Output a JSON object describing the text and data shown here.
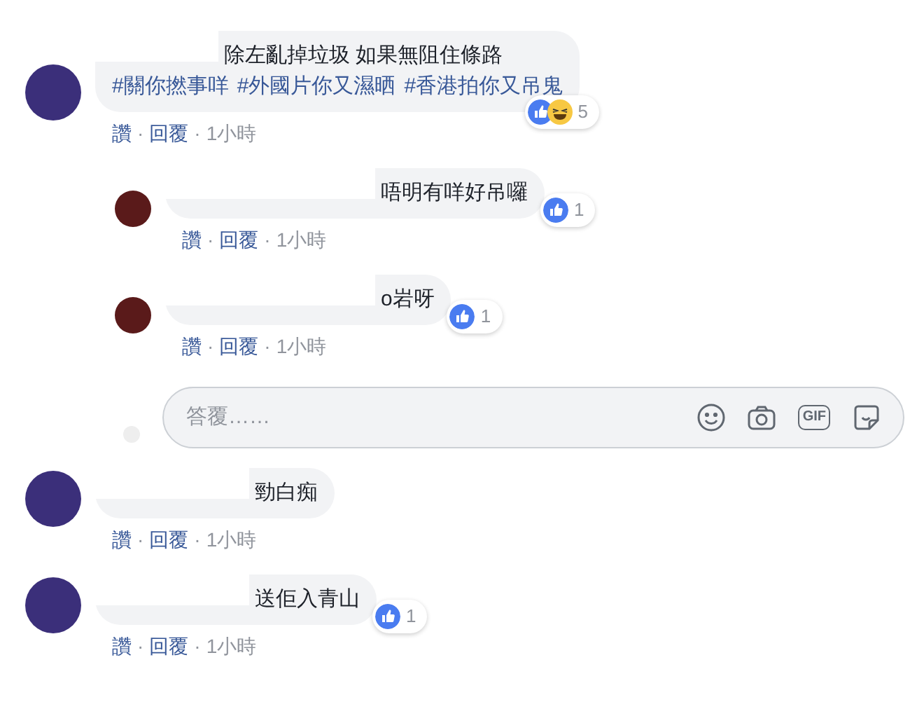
{
  "separator": "·",
  "comments": [
    {
      "kind": "comment",
      "text": "除左亂掉垃圾 如果無阻住條路",
      "hashtags": [
        "#關你撚事咩",
        "#外國片你又濕晒",
        "#香港拍你又吊鬼"
      ],
      "reactions": [
        {
          "kind": "like"
        },
        {
          "kind": "haha"
        }
      ],
      "count": "5",
      "actions": [
        "讚",
        "回覆"
      ],
      "time": "1小時"
    },
    {
      "kind": "reply",
      "text": "唔明有咩好吊囉",
      "reactions": [
        {
          "kind": "like"
        }
      ],
      "count": "1",
      "actions": [
        "讚",
        "回覆"
      ],
      "time": "1小時"
    },
    {
      "kind": "reply",
      "text": "o岩呀",
      "reactions": [
        {
          "kind": "like"
        }
      ],
      "count": "1",
      "actions": [
        "讚",
        "回覆"
      ],
      "time": "1小時"
    },
    {
      "kind": "reply_box",
      "placeholder": "答覆……",
      "gif_label": "GIF"
    },
    {
      "kind": "comment",
      "text": "勁白痴",
      "actions": [
        "讚",
        "回覆"
      ],
      "time": "1小時"
    },
    {
      "kind": "comment",
      "text": "送佢入青山",
      "reactions": [
        {
          "kind": "like"
        }
      ],
      "count": "1",
      "actions": [
        "讚",
        "回覆"
      ],
      "time": "1小時"
    }
  ]
}
